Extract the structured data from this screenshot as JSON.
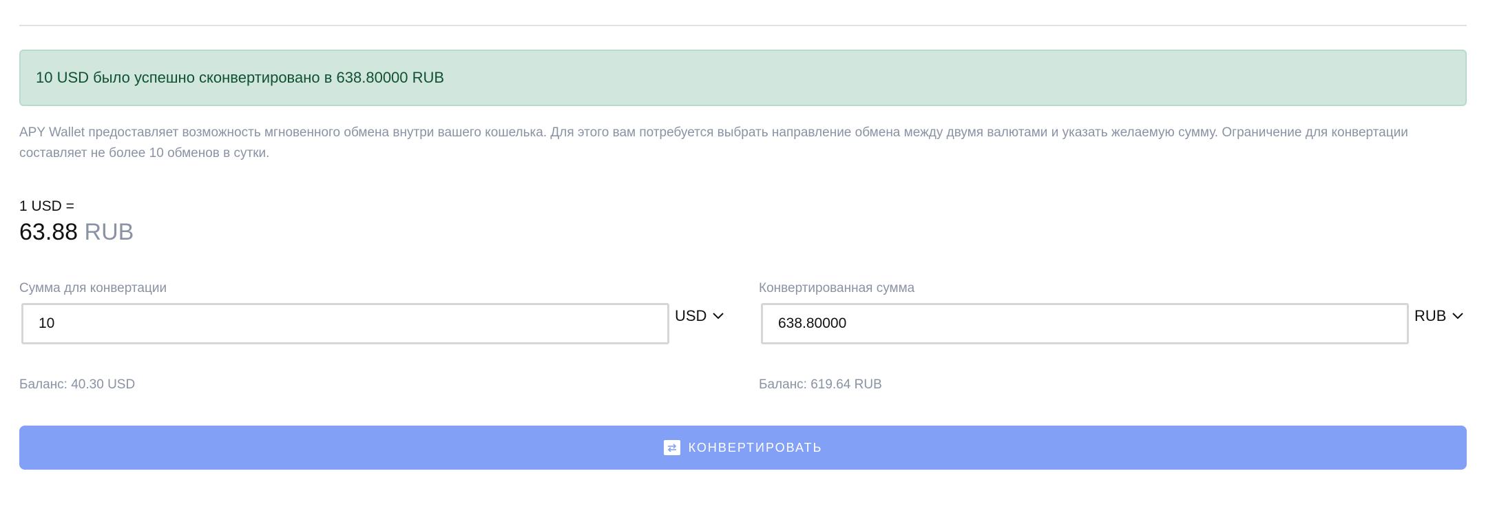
{
  "alert": {
    "message": "10 USD было успешно сконвертировано в 638.80000 RUB"
  },
  "description": "APY Wallet предоставляет возможность мгновенного обмена внутри вашего кошелька. Для этого вам потребуется выбрать направление обмена между двумя валютами и указать желаемую сумму. Ограничение для конвертации составляет не более 10 обменов в сутки.",
  "rate": {
    "label": "1 USD =",
    "value": "63.88",
    "currency": "RUB"
  },
  "from": {
    "label": "Сумма для конвертации",
    "value": "10",
    "currency": "USD",
    "balance": "Баланс: 40.30 USD"
  },
  "to": {
    "label": "Конвертированная сумма",
    "value": "638.80000",
    "currency": "RUB",
    "balance": "Баланс: 619.64 RUB"
  },
  "convert_button": {
    "label": "КОНВЕРТИРОВАТЬ",
    "icon": "exchange-icon"
  },
  "colors": {
    "alert_bg": "#d1e7dd",
    "alert_text": "#0f5132",
    "button_bg": "#82a0f6",
    "muted_text": "#8a93a3"
  }
}
